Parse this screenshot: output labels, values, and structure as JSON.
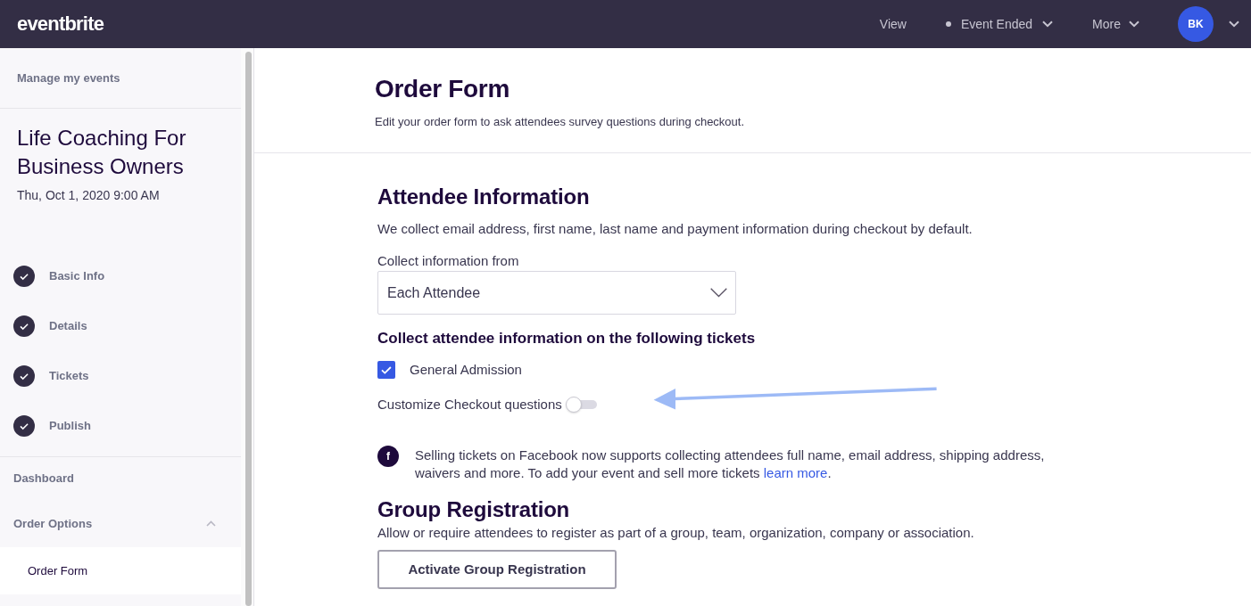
{
  "topbar": {
    "logo": "eventbrite",
    "nav": [
      {
        "kind": "link",
        "label": "View"
      },
      {
        "kind": "status",
        "label": "Event Ended"
      },
      {
        "kind": "menu",
        "label": "More"
      }
    ],
    "account": {
      "initials": "BK"
    }
  },
  "sidebar": {
    "back_link": "Manage my events",
    "event": {
      "title": "Life Coaching For Business Owners",
      "date": "Thu, Oct 1, 2020 9:00 AM"
    },
    "steps": [
      {
        "label": "Basic Info",
        "completed": true
      },
      {
        "label": "Details",
        "completed": true
      },
      {
        "label": "Tickets",
        "completed": true
      },
      {
        "label": "Publish",
        "completed": true
      }
    ],
    "items": [
      {
        "kind": "link",
        "label": "Dashboard",
        "selected": false
      },
      {
        "kind": "group",
        "label": "Order Options",
        "selected": false,
        "expanded": true,
        "children": [
          {
            "kind": "link",
            "label": "Order Form",
            "selected": true
          }
        ]
      }
    ]
  },
  "header": {
    "title": "Order Form",
    "subtitle": "Edit your order form to ask attendees survey questions during checkout."
  },
  "attendee_information": {
    "title": "Attendee Information",
    "description": "We collect email address, first name, last name and payment information during checkout by default.",
    "collect_from": {
      "label": "Collect information from",
      "value": "Each Attendee"
    },
    "tickets_heading": "Collect attendee information on the following tickets",
    "tickets": [
      {
        "label": "General Admission",
        "checked": true
      }
    ],
    "customize_checkout": {
      "label": "Customize Checkout questions",
      "on": false
    },
    "facebook_notice": {
      "icon": "f",
      "text": "Selling tickets on Facebook now supports collecting attendees full name, email address, shipping address, waivers and more. To add your event and sell more tickets",
      "link": "learn more",
      "text_after": "."
    }
  },
  "group_registration": {
    "title": "Group Registration",
    "description": "Allow or require attendees to register as part of a group, team, organization, company or association.",
    "button": "Activate Group Registration"
  }
}
